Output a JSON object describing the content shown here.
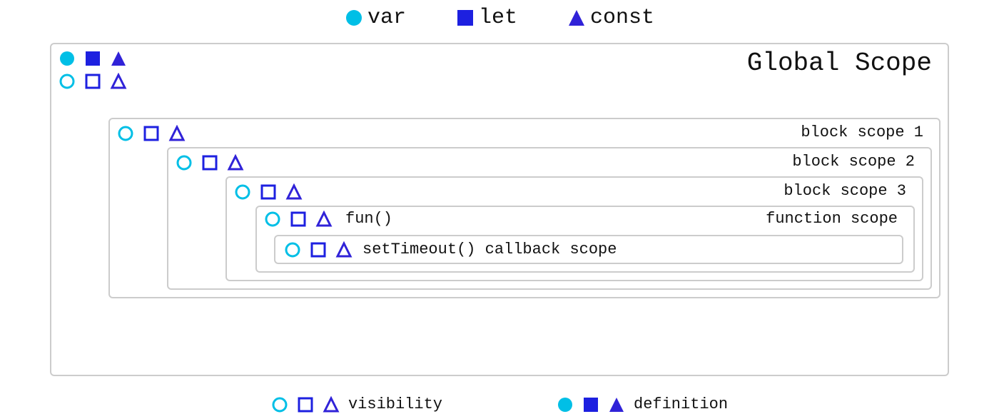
{
  "colors": {
    "var": "#00BFE6",
    "let": "#1D20E0",
    "const": "#3022D8",
    "border": "#cccccc"
  },
  "legend_top": {
    "var_label": "var",
    "let_label": "let",
    "const_label": "const"
  },
  "scopes": {
    "global": {
      "title": "Global Scope"
    },
    "block1": {
      "title": "block scope 1"
    },
    "block2": {
      "title": "block scope 2"
    },
    "block3": {
      "title": "block scope 3"
    },
    "fn": {
      "left_label": "fun()",
      "right_label": "function scope"
    },
    "cb": {
      "label": "setTimeout() callback scope"
    }
  },
  "legend_bottom": {
    "visibility_label": "visibility",
    "definition_label": "definition"
  },
  "chart_data": {
    "type": "diagram",
    "title": "JavaScript variable scope & visibility (var / let / const)",
    "shape_legend": {
      "circle": "var",
      "square": "let",
      "triangle": "const"
    },
    "fill_legend": {
      "filled": "definition",
      "outline": "visibility"
    },
    "scopes": [
      {
        "name": "Global Scope",
        "depth": 0,
        "defined": [
          "var",
          "let",
          "const"
        ],
        "visible": [
          "var",
          "let",
          "const"
        ]
      },
      {
        "name": "block scope 1",
        "depth": 1,
        "defined": [],
        "visible": [
          "var",
          "let",
          "const"
        ]
      },
      {
        "name": "block scope 2",
        "depth": 2,
        "defined": [],
        "visible": [
          "var",
          "let",
          "const"
        ]
      },
      {
        "name": "block scope 3",
        "depth": 3,
        "defined": [],
        "visible": [
          "var",
          "let",
          "const"
        ]
      },
      {
        "name": "function scope (fun())",
        "depth": 4,
        "defined": [],
        "visible": [
          "var",
          "let",
          "const"
        ]
      },
      {
        "name": "setTimeout() callback scope",
        "depth": 5,
        "defined": [],
        "visible": [
          "var",
          "let",
          "const"
        ]
      }
    ]
  }
}
